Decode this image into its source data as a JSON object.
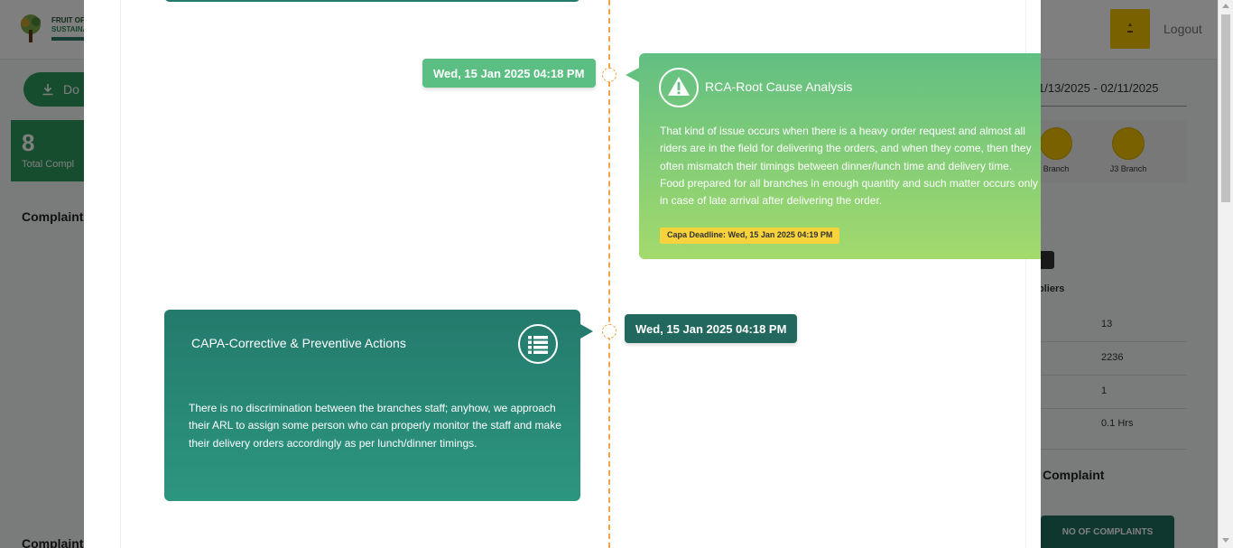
{
  "background": {
    "logo_line1": "FRUIT OF",
    "logo_line2": "SUSTAINA",
    "logout": "Logout",
    "download_label": "Do",
    "total_count": "8",
    "total_label": "Total Compl",
    "complaint_heading_1": "Complaint",
    "complaint_heading_2": "Complaint",
    "date_range": "1/13/2025 - 02/11/2025",
    "branches": [
      {
        "label": "Branch"
      },
      {
        "label": "J3 Branch"
      }
    ],
    "suppliers_label": "pliers",
    "stats": [
      "13",
      "2236",
      "1",
      "0.1 Hrs"
    ],
    "complaint_heading_3": "Complaint",
    "table_header": "NO OF COMPLAINTS",
    "colors": {
      "primary": "#2e9a5e",
      "teal": "#1f6f61",
      "brand_yellow": "#f2c200"
    }
  },
  "timeline": {
    "rca": {
      "date": "Wed, 15 Jan 2025 04:18 PM",
      "icon": "warning-icon",
      "title": "RCA-Root Cause Analysis",
      "body": "That kind of issue occurs when there is a heavy order request and almost all riders are in the field for delivering the orders, and when they come, then they often mismatch their timings between dinner/lunch time and delivery time. Food prepared for all branches in enough quantity and such matter occurs only in case of late arrival after delivering the order.",
      "deadline": "Capa Deadline: Wed, 15 Jan 2025 04:19 PM",
      "colors": {
        "start": "#62bf82",
        "end": "#a3da6c",
        "deadline_bg": "#f6d23c"
      }
    },
    "capa": {
      "date": "Wed, 15 Jan 2025 04:18 PM",
      "icon": "list-icon",
      "title": "CAPA-Corrective & Preventive Actions",
      "body": "There is no discrimination between the branches staff; anyhow, we approach their ARL to assign some person who can properly monitor the staff and make their delivery orders accordingly as per lunch/dinner timings.",
      "colors": {
        "start": "#247a6c",
        "end": "#2c9680"
      }
    },
    "line_color": "#f0a34a"
  }
}
